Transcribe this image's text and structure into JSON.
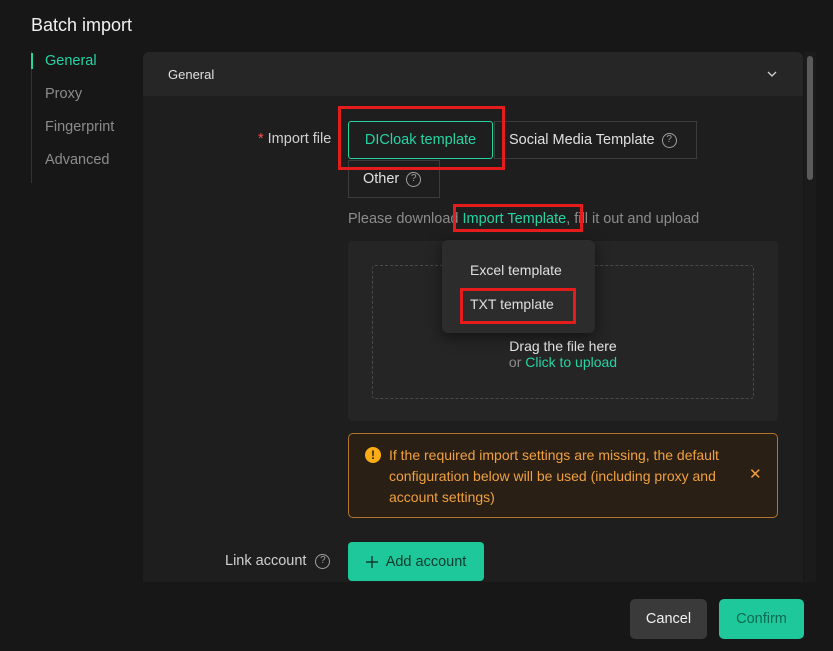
{
  "dialog": {
    "title": "Batch import"
  },
  "nav": {
    "items": [
      "General",
      "Proxy",
      "Fingerprint",
      "Advanced"
    ],
    "active": "General"
  },
  "section": {
    "title": "General"
  },
  "import_file": {
    "required_mark": "*",
    "label": "Import file",
    "options": [
      "DICloak template",
      "Social Media Template",
      "Other"
    ],
    "selected": "DICloak template",
    "help_icon": "question-circle-icon"
  },
  "hint": {
    "prefix": "Please download",
    "link": "Import Template",
    "suffix": ", fill it out and upload"
  },
  "dropdown": {
    "items": [
      "Excel template",
      "TXT template"
    ]
  },
  "upload": {
    "drag_text": "Drag the file here",
    "or_text": "or",
    "click_text": "Click to upload"
  },
  "alert": {
    "icon": "warning-circle-icon",
    "text": "If the required import settings are missing, the default configuration below will be used (including proxy and account settings)",
    "close_icon": "close-icon"
  },
  "link_account": {
    "label": "Link account",
    "button": "Add account"
  },
  "footer": {
    "cancel": "Cancel",
    "confirm": "Confirm"
  },
  "colors": {
    "accent": "#26d4a2",
    "warning": "#f0a040",
    "highlight": "#e51c1c"
  }
}
